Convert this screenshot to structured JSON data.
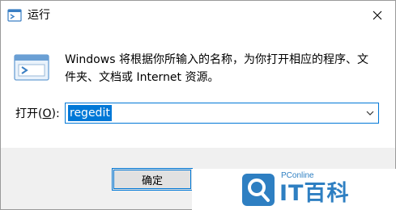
{
  "window": {
    "title": "运行",
    "close_icon": "close-icon"
  },
  "dialog": {
    "description_line1": "Windows 将根据你所输入的名称，为你打开相应的程序、文件",
    "description_line1_cont": "件",
    "description_line2": "夹、文档或 Internet 资源。",
    "open_label_prefix": "打开(",
    "open_label_key": "O",
    "open_label_suffix": "):",
    "input_value": "regedit"
  },
  "buttons": {
    "ok_label": "确定"
  },
  "watermark": {
    "brand_small": "PConline",
    "brand_large": "IT百科"
  },
  "colors": {
    "accent": "#0078d7",
    "watermark_blue": "#2e7fc2"
  }
}
